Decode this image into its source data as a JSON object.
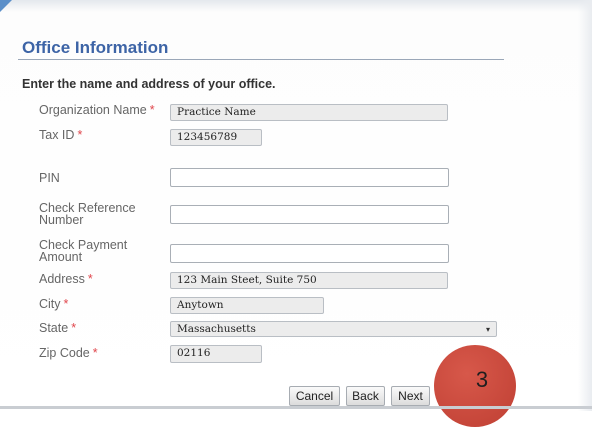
{
  "section": {
    "title": "Office Information",
    "intro": "Enter the name and address of your office."
  },
  "fields": {
    "organization_name": {
      "label": "Organization Name",
      "required": "*",
      "value": "Practice Name"
    },
    "tax_id": {
      "label": "Tax ID",
      "required": "*",
      "value": "123456789"
    },
    "pin": {
      "label": "PIN",
      "value": ""
    },
    "check_reference": {
      "label_line1": "Check Reference",
      "label_line2": "Number",
      "value": ""
    },
    "check_payment": {
      "label_line1": "Check Payment",
      "label_line2": "Amount",
      "value": ""
    },
    "address": {
      "label": "Address",
      "required": "*",
      "value": "123 Main Steet, Suite 750"
    },
    "city": {
      "label": "City",
      "required": "*",
      "value": "Anytown"
    },
    "state": {
      "label": "State",
      "required": "*",
      "value": "Massachusetts",
      "arrow": "▾"
    },
    "zip": {
      "label": "Zip Code",
      "required": "*",
      "value": "02116"
    }
  },
  "buttons": {
    "cancel": "Cancel",
    "back": "Back",
    "next": "Next"
  },
  "step_badge": "3",
  "colors": {
    "title": "#3d64a6",
    "required": "#e0454b",
    "badge": "#c9483b"
  }
}
